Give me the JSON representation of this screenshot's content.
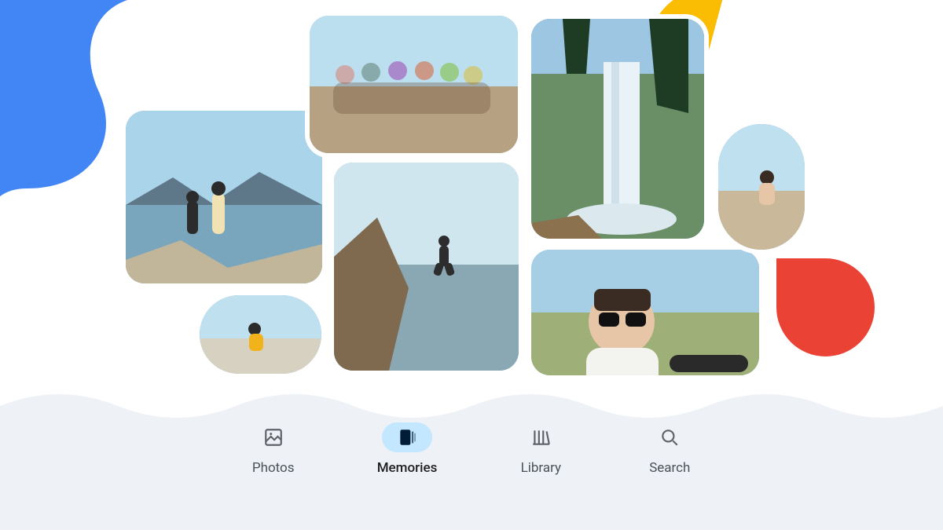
{
  "nav": {
    "items": [
      {
        "label": "Photos",
        "icon": "image-icon",
        "active": false
      },
      {
        "label": "Memories",
        "icon": "memories-icon",
        "active": true
      },
      {
        "label": "Library",
        "icon": "library-icon",
        "active": false
      },
      {
        "label": "Search",
        "icon": "search-icon",
        "active": false
      }
    ]
  },
  "decor": {
    "blue": "#4285f4",
    "yellow": "#fabd04",
    "red": "#ea4335"
  },
  "collage": {
    "tiles": [
      {
        "name": "photo-lake-standing",
        "shape": "rounded"
      },
      {
        "name": "photo-group-rocks",
        "shape": "rounded"
      },
      {
        "name": "photo-cliff-jump",
        "shape": "rounded"
      },
      {
        "name": "photo-waterfall",
        "shape": "rounded"
      },
      {
        "name": "photo-selfie",
        "shape": "rounded"
      },
      {
        "name": "photo-sitting-small",
        "shape": "pill"
      },
      {
        "name": "photo-sitting-rock",
        "shape": "pill"
      }
    ]
  }
}
